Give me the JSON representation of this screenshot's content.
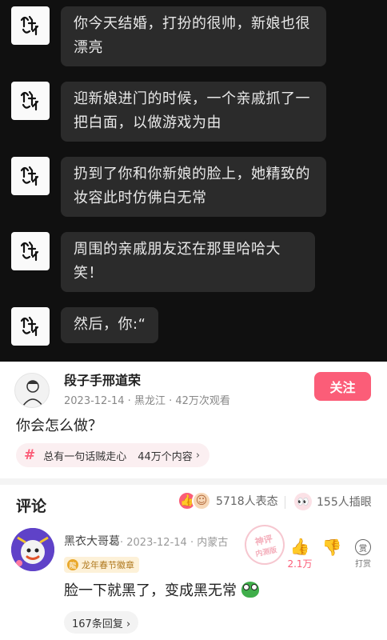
{
  "chat": {
    "messages": [
      {
        "text": "你今天结婚，打扮的很帅，新娘也很漂亮"
      },
      {
        "text": "迎新娘进门的时候，一个亲戚抓了一把白面，以做游戏为由"
      },
      {
        "text": "扔到了你和你新娘的脸上，她精致的妆容此时仿佛白无常"
      },
      {
        "text": "周围的亲戚朋友还在那里哈哈大笑！"
      },
      {
        "text": "然后，你:“"
      }
    ]
  },
  "author": {
    "name": "段子手邢道荣",
    "meta": "2023-12-14 · 黑龙江 · 42万次观看",
    "follow_label": "关注",
    "question": "你会怎么做？",
    "topic": {
      "hash": "#",
      "title": "总有一句话贼走心",
      "count": "44万个内容",
      "arrow": "›"
    }
  },
  "comments_header": {
    "title": "评论",
    "reactions_text": "5718人表态",
    "eyes_text": "155人插眼"
  },
  "comment": {
    "user": "黑衣大哥葛",
    "meta": "· 2023-12-14 · 内蒙古",
    "badge": "龙年春节徽章",
    "stamp_line1": "神评",
    "stamp_line2": "内测版",
    "like_count": "2.1万",
    "tip_label": "打赏",
    "text": "脸一下就黑了，变成黑无常",
    "replies": "167条回复 ›"
  },
  "colors": {
    "accent": "#fb5d78",
    "chat_bg": "#101010",
    "bubble": "#2b2b2b"
  }
}
